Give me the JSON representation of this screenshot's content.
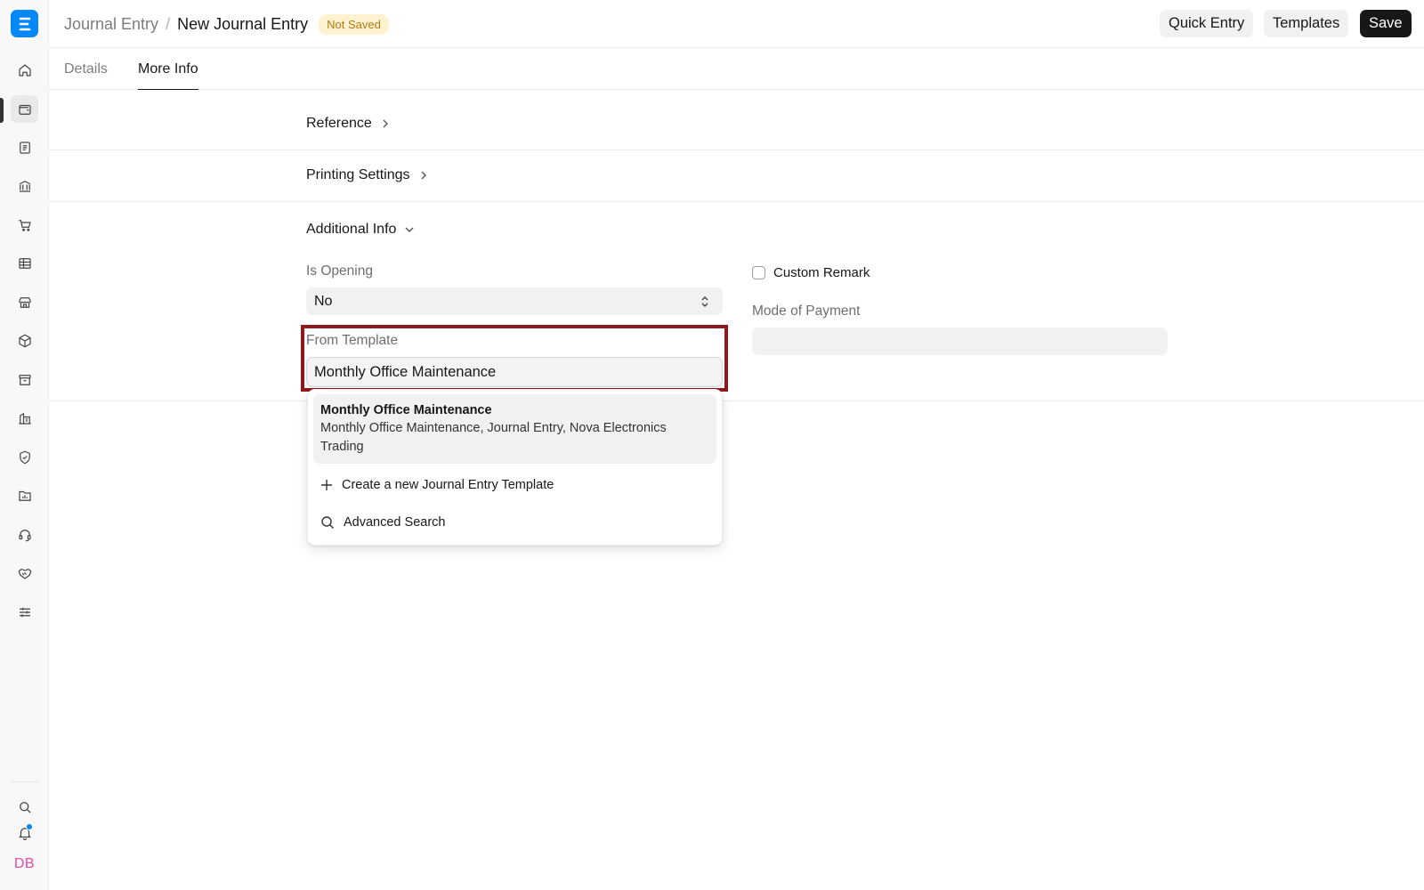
{
  "header": {
    "breadcrumb_parent": "Journal Entry",
    "breadcrumb_sep": "/",
    "breadcrumb_current": "New Journal Entry",
    "status": "Not Saved",
    "buttons": {
      "quick_entry": "Quick Entry",
      "templates": "Templates",
      "save": "Save"
    }
  },
  "tabs": [
    {
      "label": "Details"
    },
    {
      "label": "More Info"
    }
  ],
  "sections": {
    "reference": "Reference",
    "printing_settings": "Printing Settings",
    "additional_info": "Additional Info"
  },
  "form": {
    "is_opening_label": "Is Opening",
    "is_opening_value": "No",
    "from_template_label": "From Template",
    "from_template_value": "Monthly Office Maintenance",
    "custom_remark_label": "Custom Remark",
    "custom_remark_checked": false,
    "mode_of_payment_label": "Mode of Payment",
    "mode_of_payment_value": ""
  },
  "dropdown": {
    "selected_title": "Monthly Office Maintenance",
    "selected_desc": "Monthly Office Maintenance, Journal Entry, Nova Electronics Trading",
    "create_label": "Create a new Journal Entry Template",
    "advanced_label": "Advanced Search"
  },
  "user": {
    "initials": "DB"
  },
  "colors": {
    "accent": "#0289f7",
    "highlight": "#8e1a1c",
    "avatar": "#e34aa6"
  }
}
